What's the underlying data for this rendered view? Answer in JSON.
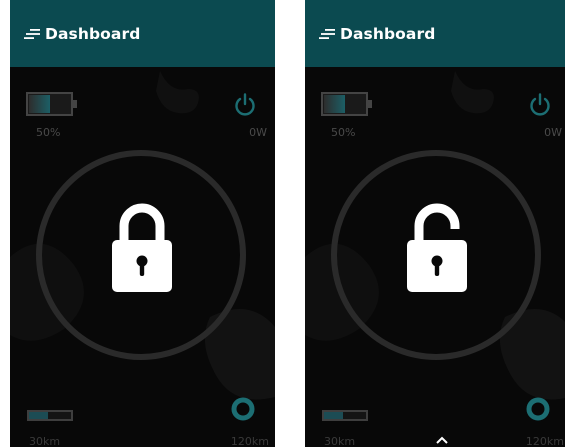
{
  "screens": [
    {
      "title": "Dashboard",
      "battery": {
        "percent_label": "50%",
        "level": 0.5
      },
      "power": {
        "label": "0W"
      },
      "lock_state": "locked",
      "range": {
        "min_label": "30km",
        "max_label": "120km",
        "level": 0.45
      },
      "icons": [
        "menu-icon",
        "battery-icon",
        "power-icon",
        "lock-closed-icon",
        "location-icon"
      ]
    },
    {
      "title": "Dashboard",
      "battery": {
        "percent_label": "50%",
        "level": 0.5
      },
      "power": {
        "label": "0W"
      },
      "lock_state": "unlocked",
      "range": {
        "min_label": "30km",
        "max_label": "120km",
        "level": 0.45
      },
      "icons": [
        "menu-icon",
        "battery-icon",
        "power-icon",
        "lock-open-icon",
        "location-icon",
        "chevron-up-icon"
      ]
    }
  ],
  "colors": {
    "header_bg": "#0b4a50",
    "screen_bg": "#080808",
    "accent": "#1c6e73",
    "lock": "#ffffff"
  }
}
